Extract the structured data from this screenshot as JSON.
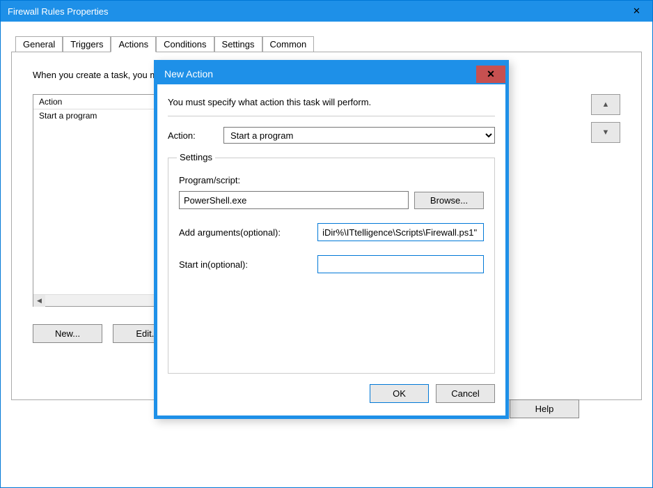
{
  "mainWindow": {
    "title": "Firewall Rules Properties",
    "closeSymbol": "✕"
  },
  "tabs": {
    "items": [
      "General",
      "Triggers",
      "Actions",
      "Conditions",
      "Settings",
      "Common"
    ],
    "activeIndex": 2
  },
  "actionsTab": {
    "instruction": "When you create a task, you must specify the action that will occur when your task starts.",
    "listHeader": "Action",
    "listItems": [
      "Start a program"
    ],
    "buttons": {
      "new": "New...",
      "edit": "Edit...",
      "help": "Help"
    },
    "arrowUp": "▲",
    "arrowDown": "▼"
  },
  "modal": {
    "title": "New Action",
    "closeSymbol": "✕",
    "instruction": "You must specify what action this task will perform.",
    "actionLabel": "Action:",
    "actionValue": "Start a program",
    "settings": {
      "legend": "Settings",
      "programLabel": "Program/script:",
      "programValue": "PowerShell.exe",
      "browse": "Browse...",
      "argsLabel": "Add arguments(optional):",
      "argsValue": "iDir%\\ITtelligence\\Scripts\\Firewall.ps1\"",
      "startInLabel": "Start in(optional):",
      "startInValue": ""
    },
    "footer": {
      "ok": "OK",
      "cancel": "Cancel"
    }
  }
}
